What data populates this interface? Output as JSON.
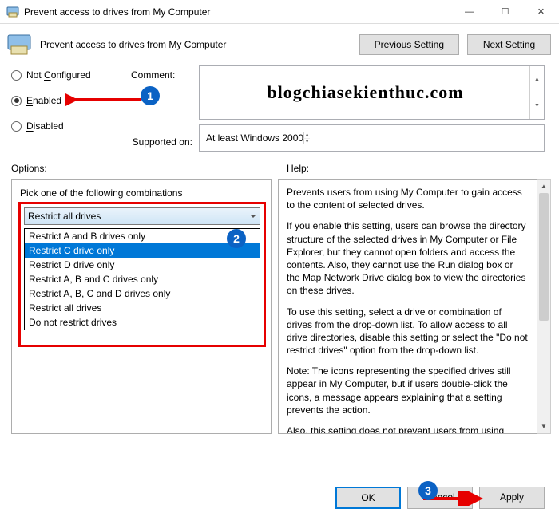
{
  "window": {
    "title": "Prevent access to drives from My Computer",
    "heading": "Prevent access to drives from My Computer"
  },
  "nav": {
    "previous": "Previous Setting",
    "next": "Next Setting"
  },
  "state": {
    "not_configured": "Not Configured",
    "enabled": "Enabled",
    "disabled": "Disabled"
  },
  "labels": {
    "comment": "Comment:",
    "supported_on": "Supported on:",
    "options": "Options:",
    "help": "Help:"
  },
  "comment_watermark": "blogchiasekienthuc.com",
  "supported_value": "At least Windows 2000",
  "options": {
    "pick_label": "Pick one of the following combinations",
    "selected": "Restrict all drives",
    "items": [
      "Restrict A and B drives only",
      "Restrict C drive only",
      "Restrict D drive only",
      "Restrict A, B and C drives only",
      "Restrict A, B, C and D drives only",
      "Restrict all drives",
      "Do not restrict drives"
    ],
    "highlighted_index": 1
  },
  "help_text": {
    "p1": "Prevents users from using My Computer to gain access to the content of selected drives.",
    "p2": "If you enable this setting, users can browse the directory structure of the selected drives in My Computer or File Explorer, but they cannot open folders and access the contents. Also, they cannot use the Run dialog box or the Map Network Drive dialog box to view the directories on these drives.",
    "p3": "To use this setting, select a drive or combination of drives from the drop-down list. To allow access to all drive directories, disable this setting or select the \"Do not restrict drives\" option from the drop-down list.",
    "p4": "Note: The icons representing the specified drives still appear in My Computer, but if users double-click the icons, a message appears explaining that a setting prevents the action.",
    "p5": " Also, this setting does not prevent users from using programs to access local and network drives. And, it does not prevent them"
  },
  "buttons": {
    "ok": "OK",
    "cancel": "Cancel",
    "apply": "Apply"
  },
  "callouts": {
    "c1": "1",
    "c2": "2",
    "c3": "3"
  }
}
